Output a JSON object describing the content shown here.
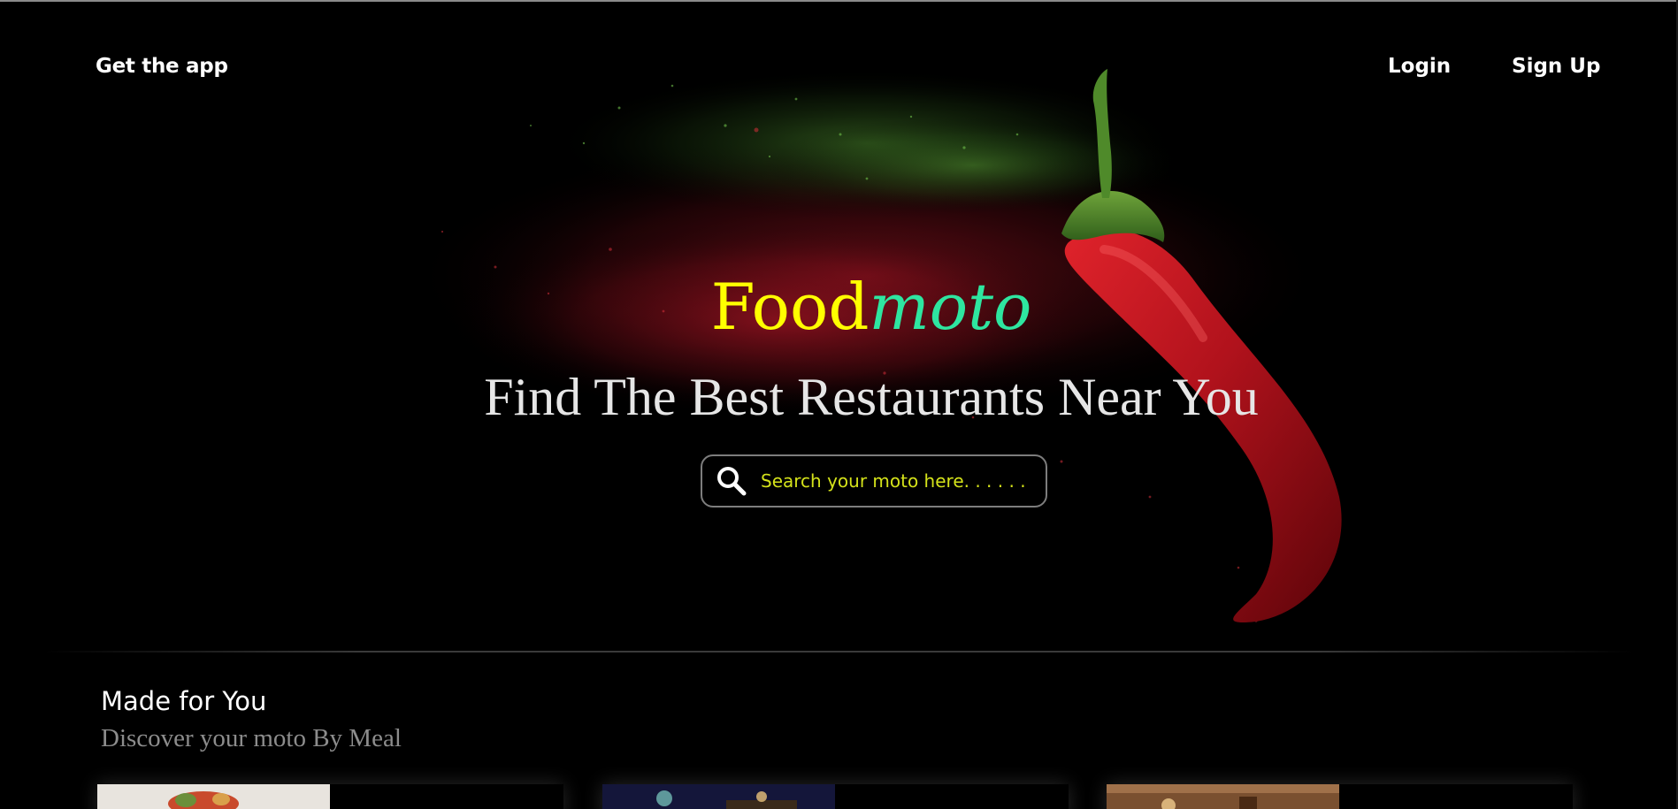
{
  "nav": {
    "get_app": "Get the app",
    "login": "Login",
    "signup": "Sign Up"
  },
  "hero": {
    "brand_food": "Food",
    "brand_moto": "moto",
    "tagline": "Find The Best Restaurants Near You",
    "search_placeholder": "Search your moto here. . . . . .",
    "search_icon": "search-icon"
  },
  "made_for_you": {
    "title": "Made for You",
    "subtitle": "Discover your moto By Meal",
    "cards": [
      {
        "image": "salad-dish-image"
      },
      {
        "image": "restaurant-night-image"
      },
      {
        "image": "dining-table-image"
      }
    ]
  },
  "colors": {
    "brand_food": "#ffff00",
    "brand_moto": "#2ee6a0",
    "search_text": "#d4e21a",
    "background": "#000000"
  }
}
